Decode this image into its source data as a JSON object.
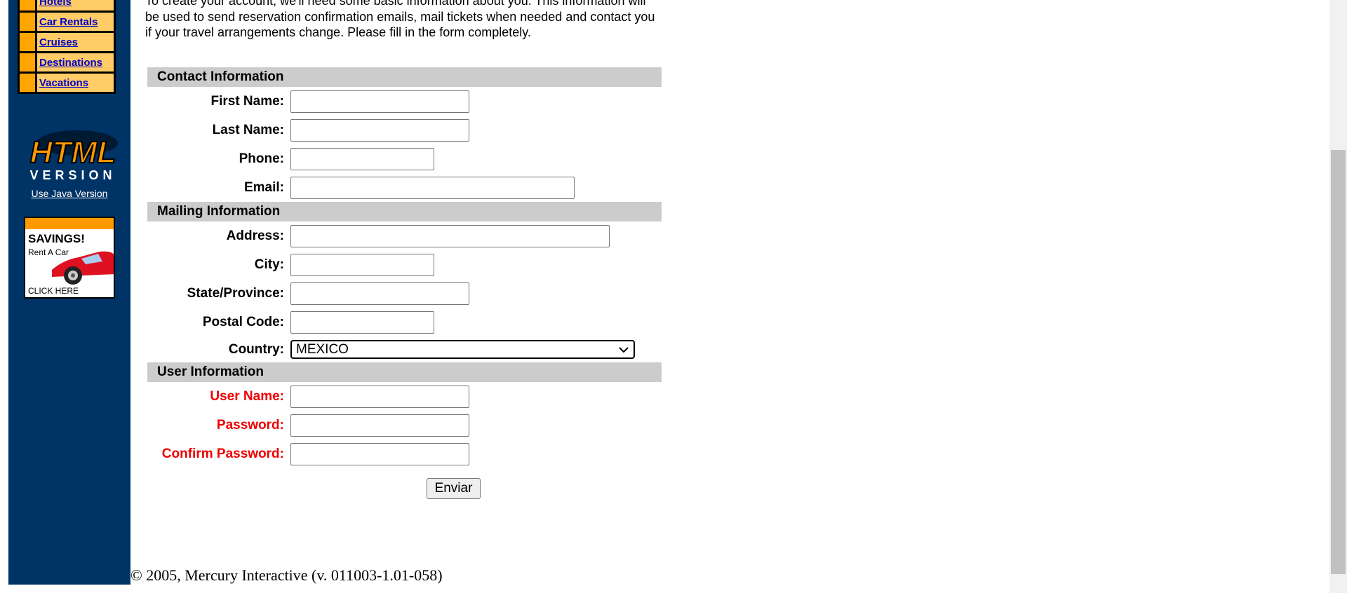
{
  "sidebar": {
    "menu_items": [
      {
        "label": "Hotels"
      },
      {
        "label": "Car Rentals"
      },
      {
        "label": "Cruises"
      },
      {
        "label": "Destinations"
      },
      {
        "label": "Vacations"
      }
    ],
    "logo_line1": "HTML",
    "logo_line2": "VERSION",
    "java_link": "Use Java Version",
    "ad": {
      "title": "SAVINGS!",
      "subtitle": "Rent A Car",
      "cta": "CLICK HERE"
    }
  },
  "intro_text": "To create your account, we'll need some basic information about you. This information will be used to send reservation confirmation emails, mail tickets when needed and contact you if your travel arrangements change. Please fill in the form completely.",
  "sections": {
    "contact": "Contact Information",
    "mailing": "Mailing Information",
    "user": "User Information"
  },
  "labels": {
    "first_name": "First Name:",
    "last_name": "Last Name:",
    "phone": "Phone:",
    "email": "Email:",
    "address": "Address:",
    "city": "City:",
    "state": "State/Province:",
    "postal": "Postal Code:",
    "country": "Country:",
    "username": "User Name:",
    "password": "Password:",
    "confirm_password": "Confirm Password:"
  },
  "values": {
    "first_name": "",
    "last_name": "",
    "phone": "",
    "email": "",
    "address": "",
    "city": "",
    "state": "",
    "postal": "",
    "country": "MEXICO",
    "username": "",
    "password": "",
    "confirm_password": ""
  },
  "submit_label": "Enviar",
  "footer": "© 2005, Mercury Interactive (v. 011003-1.01-058)",
  "colors": {
    "sidebar": "#003366",
    "menu_bullet": "#ffa500",
    "menu_cell": "#ffcc66",
    "section_header": "#cccccc",
    "required_label": "#ee0000"
  }
}
